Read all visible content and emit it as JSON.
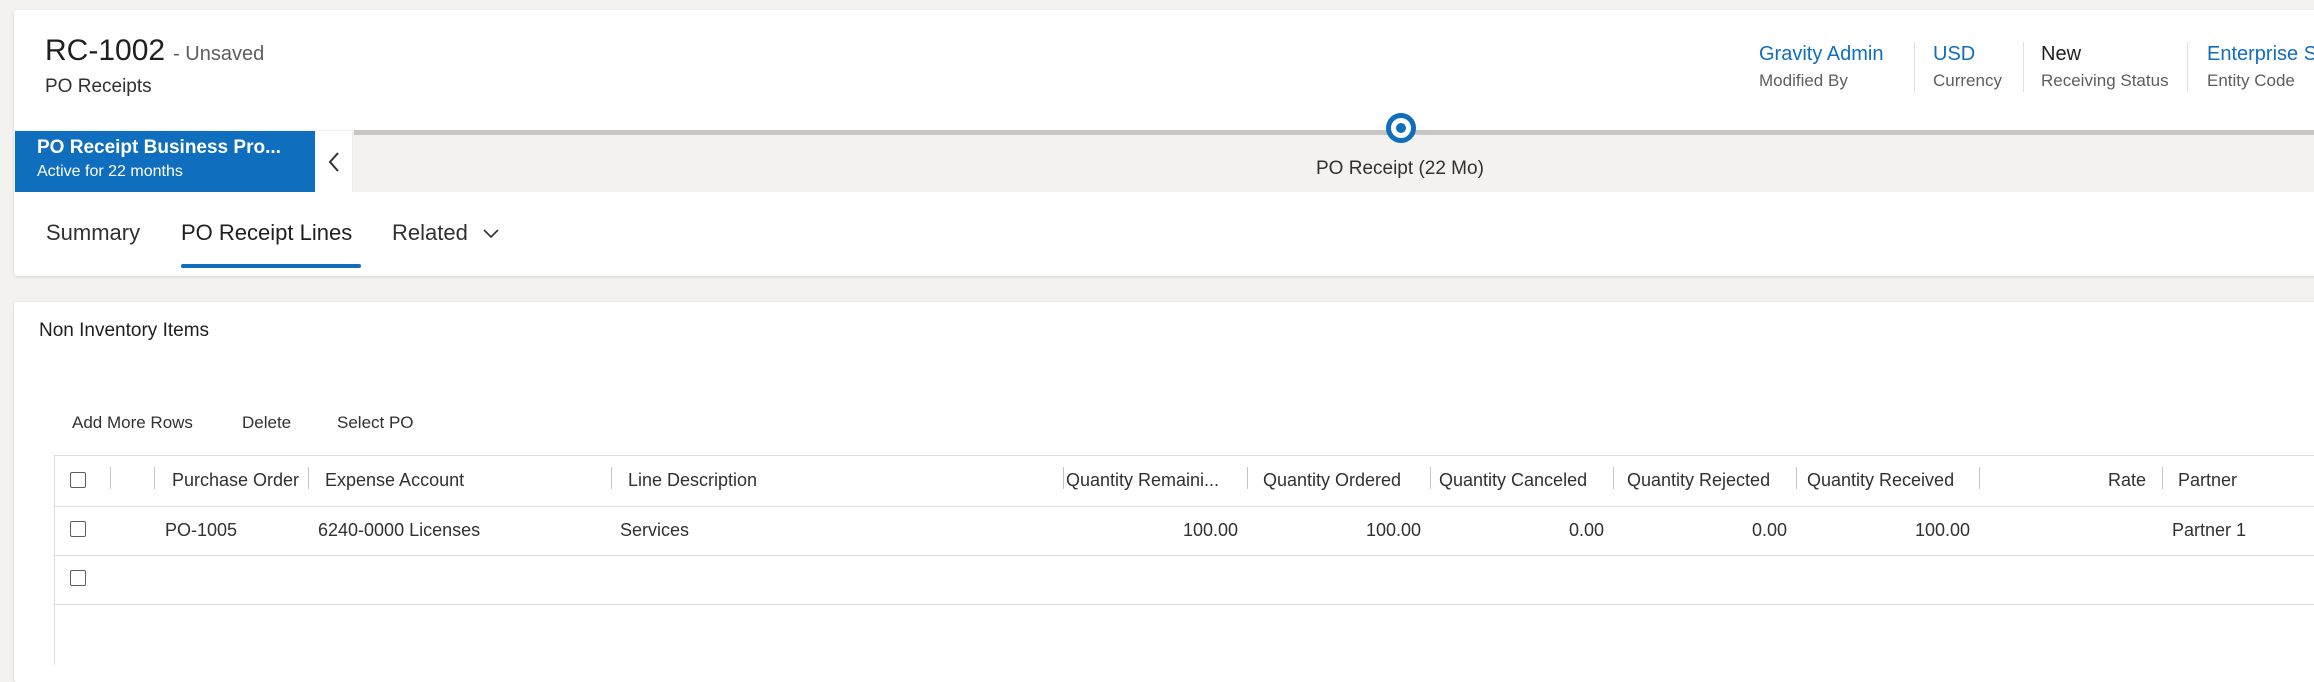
{
  "record": {
    "title": "RC-1002",
    "status": "- Unsaved",
    "entity_type": "PO Receipts"
  },
  "header_fields": [
    {
      "value": "Gravity Admin",
      "label": "Modified By"
    },
    {
      "value": "USD",
      "label": "Currency"
    },
    {
      "value": "New",
      "label": "Receiving Status"
    },
    {
      "value": "Enterprise S",
      "label": "Entity Code"
    }
  ],
  "bpf": {
    "name": "PO Receipt Business Pro...",
    "duration": "Active for 22 months",
    "stage_label": "PO Receipt",
    "stage_duration": "(22 Mo)"
  },
  "tabs": [
    "Summary",
    "PO Receipt Lines",
    "Related"
  ],
  "active_tab": "PO Receipt Lines",
  "section": {
    "title": "Non Inventory Items",
    "commands": [
      "Add More Rows",
      "Delete",
      "Select PO"
    ]
  },
  "grid": {
    "columns": [
      "Purchase Order",
      "Expense Account",
      "Line Description",
      "Quantity Remaini...",
      "Quantity Ordered",
      "Quantity Canceled",
      "Quantity Rejected",
      "Quantity Received",
      "Rate",
      "Partner"
    ],
    "rows": [
      [
        "PO-1005",
        "6240-0000 Licenses",
        "Services",
        "100.00",
        "100.00",
        "0.00",
        "0.00",
        "100.00",
        "",
        "Partner 1"
      ]
    ]
  },
  "colors": {
    "accent": "#106ebe",
    "text": "#323130",
    "background": "#f3f2f1"
  }
}
